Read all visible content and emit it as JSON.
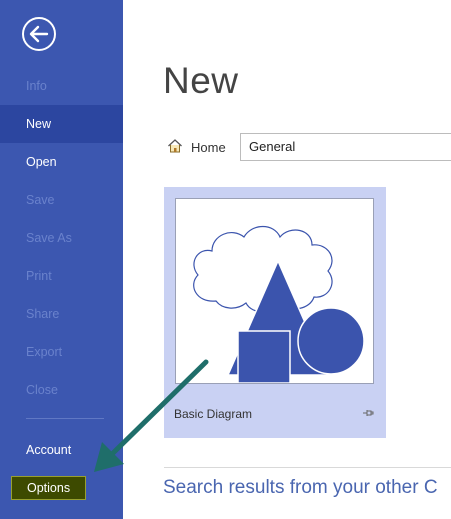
{
  "sidebar": {
    "back_icon": "back-arrow-icon",
    "items": [
      {
        "label": "Info",
        "state": "disabled"
      },
      {
        "label": "New",
        "state": "selected"
      },
      {
        "label": "Open",
        "state": "enabled"
      },
      {
        "label": "Save",
        "state": "disabled"
      },
      {
        "label": "Save As",
        "state": "disabled"
      },
      {
        "label": "Print",
        "state": "disabled"
      },
      {
        "label": "Share",
        "state": "disabled"
      },
      {
        "label": "Export",
        "state": "disabled"
      },
      {
        "label": "Close",
        "state": "disabled"
      }
    ],
    "account_label": "Account",
    "options_label": "Options"
  },
  "main": {
    "title": "New",
    "breadcrumb": {
      "home_label": "Home",
      "home_icon": "home-icon"
    },
    "category_value": "General",
    "templates": [
      {
        "name": "Basic Diagram",
        "pin_icon": "pin-icon"
      }
    ],
    "search_heading": "Search results from your other C"
  },
  "colors": {
    "sidebar_bg": "#3c57b0",
    "sidebar_selected": "#2c46a0",
    "options_highlight": "#3d4a00",
    "card_bg": "#c9d1f3",
    "shape_fill": "#3b54ad",
    "annotation_arrow": "#1f6e6a"
  }
}
